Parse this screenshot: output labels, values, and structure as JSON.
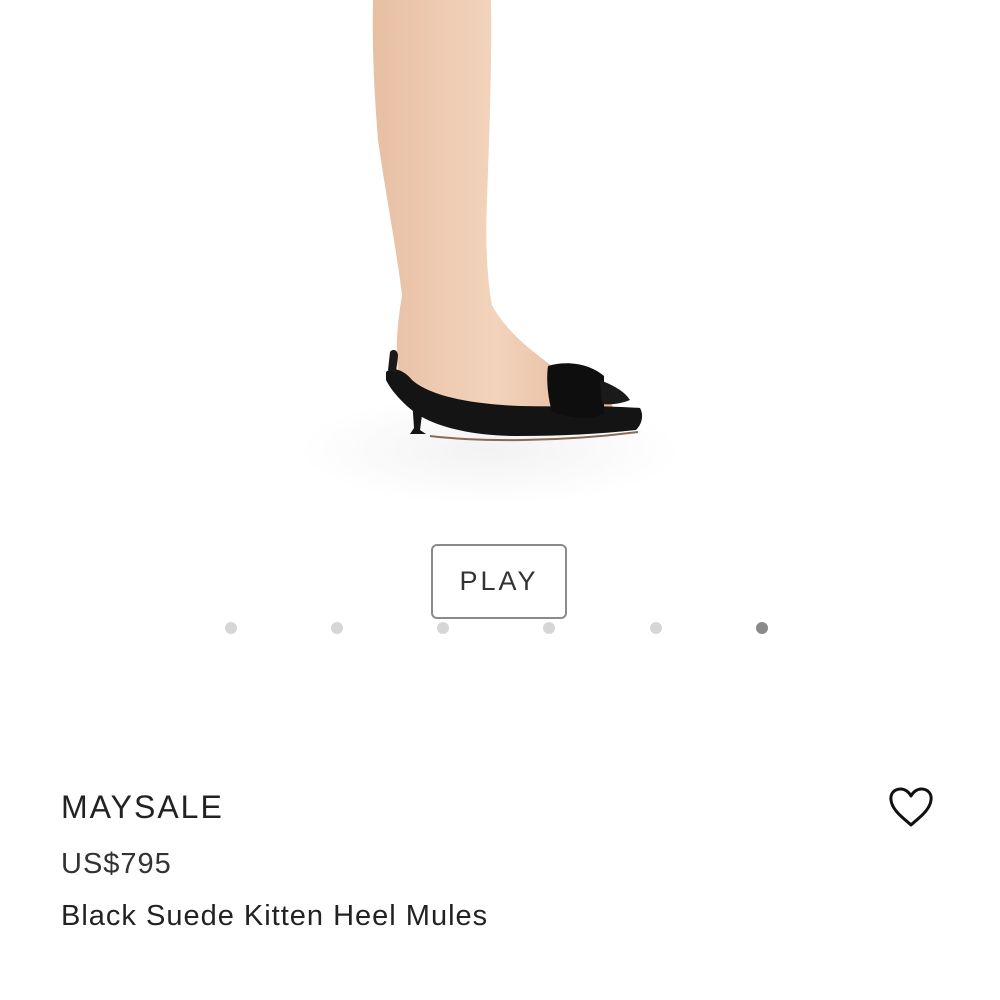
{
  "media": {
    "image_alt": "Black Suede Kitten Heel Mules",
    "play_label": "PLAY",
    "carousel": {
      "total": 6,
      "active_index": 5
    }
  },
  "product": {
    "brand": "MAYSALE",
    "price": "US$795",
    "name": "Black Suede Kitten Heel Mules"
  },
  "actions": {
    "wishlist_icon": "heart-outline-icon"
  },
  "colors": {
    "dot_inactive": "#d6d6d6",
    "dot_active": "#8a8a8a",
    "text": "#222222"
  }
}
